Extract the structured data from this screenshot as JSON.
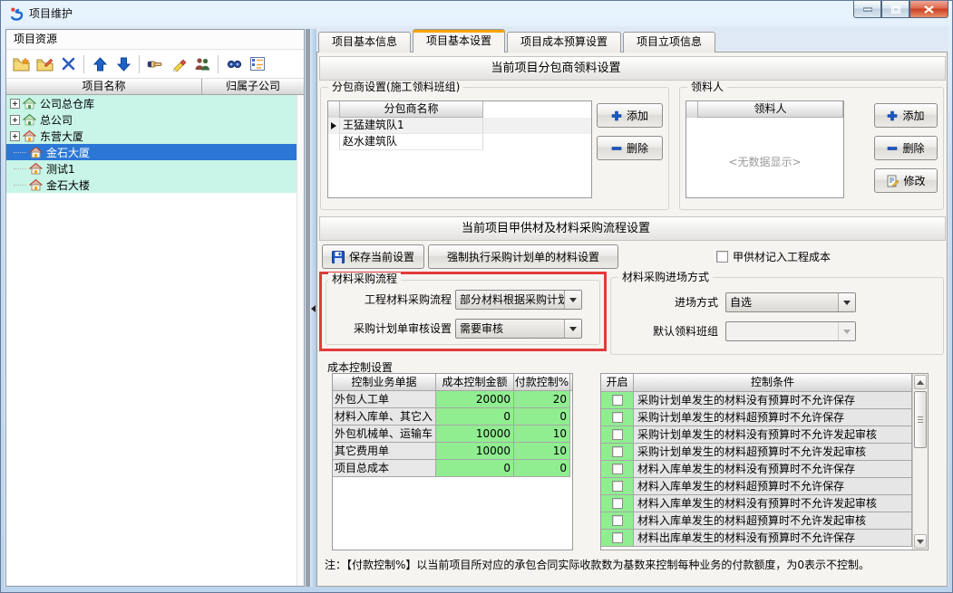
{
  "window": {
    "title": "项目维护",
    "controls": [
      "minimize",
      "maximize",
      "close"
    ]
  },
  "colors": {
    "tree_row_bg": "#c8f5e7",
    "selected_row_bg": "#2c77d6",
    "green_cell": "#90ee90",
    "tab_accent": "#f7a400",
    "highlight_box": "#e23b3b"
  },
  "left_panel": {
    "header": "项目资源",
    "toolbar": {
      "icons": [
        "new-folder-icon",
        "edit-folder-icon",
        "delete-icon",
        "move-up-icon",
        "move-down-icon",
        "select-hand-icon",
        "erase-edit-icon",
        "users-icon",
        "search-icon",
        "view-list-icon"
      ]
    },
    "tree": {
      "columns": [
        "项目名称",
        "归属子公司"
      ],
      "items": [
        {
          "label": "公司总仓库",
          "icon": "house-green",
          "expandable": true,
          "level": 0,
          "selected": false
        },
        {
          "label": "总公司",
          "icon": "house-green",
          "expandable": true,
          "level": 0,
          "selected": false
        },
        {
          "label": "东营大厦",
          "icon": "house-red",
          "expandable": true,
          "level": 0,
          "selected": false
        },
        {
          "label": "金石大厦",
          "icon": "house-red",
          "expandable": false,
          "level": 1,
          "selected": true
        },
        {
          "label": "测试1",
          "icon": "house-red",
          "expandable": false,
          "level": 1,
          "selected": false
        },
        {
          "label": "金石大楼",
          "icon": "house-red",
          "expandable": false,
          "level": 1,
          "selected": false
        }
      ]
    }
  },
  "right_panel": {
    "tabs": [
      {
        "label": "项目基本信息",
        "active": false
      },
      {
        "label": "项目基本设置",
        "active": true
      },
      {
        "label": "项目成本预算设置",
        "active": false
      },
      {
        "label": "项目立项信息",
        "active": false
      }
    ],
    "section1": {
      "title": "当前项目分包商领料设置",
      "subcontractor": {
        "legend": "分包商设置(施工领料班组)",
        "column": "分包商名称",
        "rows": [
          "王猛建筑队1",
          "赵水建筑队"
        ],
        "add_label": "添加",
        "delete_label": "删除"
      },
      "picker": {
        "legend": "领料人",
        "column": "领料人",
        "empty_text": "<无数据显示>",
        "add_label": "添加",
        "delete_label": "删除",
        "modify_label": "修改"
      }
    },
    "section2": {
      "title": "当前项目甲供材及材料采购流程设置",
      "save_label": "保存当前设置",
      "force_label": "强制执行采购计划单的材料设置",
      "checkbox_label": "甲供材记入工程成本",
      "checkbox_checked": false,
      "flow": {
        "legend": "材料采购流程",
        "fields": [
          {
            "label": "工程材料采购流程",
            "value": "部分材料根据采购计划",
            "disabled": false
          },
          {
            "label": "采购计划单审核设置",
            "value": "需要审核",
            "disabled": false
          }
        ]
      },
      "entry": {
        "legend": "材料采购进场方式",
        "fields": [
          {
            "label": "进场方式",
            "value": "自选",
            "disabled": false
          },
          {
            "label": "默认领料班组",
            "value": "",
            "disabled": true
          }
        ]
      },
      "cost_control": {
        "title": "成本控制设置",
        "columns": [
          "控制业务单据",
          "成本控制金额",
          "付款控制%"
        ],
        "rows": [
          {
            "doc": "外包人工单",
            "amount": "20000",
            "pct": "20"
          },
          {
            "doc": "材料入库单、其它入",
            "amount": "0",
            "pct": "0"
          },
          {
            "doc": "外包机械单、运输车",
            "amount": "10000",
            "pct": "10"
          },
          {
            "doc": "其它费用单",
            "amount": "10000",
            "pct": "10"
          },
          {
            "doc": "项目总成本",
            "amount": "0",
            "pct": "0"
          }
        ]
      },
      "conditions": {
        "columns": [
          "开启",
          "控制条件"
        ],
        "rows": [
          {
            "checked": false,
            "text": "采购计划单发生的材料没有预算时不允许保存"
          },
          {
            "checked": false,
            "text": "采购计划单发生的材料超预算时不允许保存"
          },
          {
            "checked": false,
            "text": "采购计划单发生的材料没有预算时不允许发起审核"
          },
          {
            "checked": false,
            "text": "采购计划单发生的材料超预算时不允许发起审核"
          },
          {
            "checked": false,
            "text": "材料入库单发生的材料没有预算时不允许保存"
          },
          {
            "checked": false,
            "text": "材料入库单发生的材料超预算时不允许保存"
          },
          {
            "checked": false,
            "text": "材料入库单发生的材料没有预算时不允许发起审核"
          },
          {
            "checked": false,
            "text": "材料入库单发生的材料超预算时不允许发起审核"
          },
          {
            "checked": false,
            "text": "材料出库单发生的材料没有预算时不允许保存"
          }
        ]
      },
      "note": "注：【付款控制%】以当前项目所对应的承包合同实际收款数为基数来控制每种业务的付款额度，为0表示不控制。"
    }
  }
}
